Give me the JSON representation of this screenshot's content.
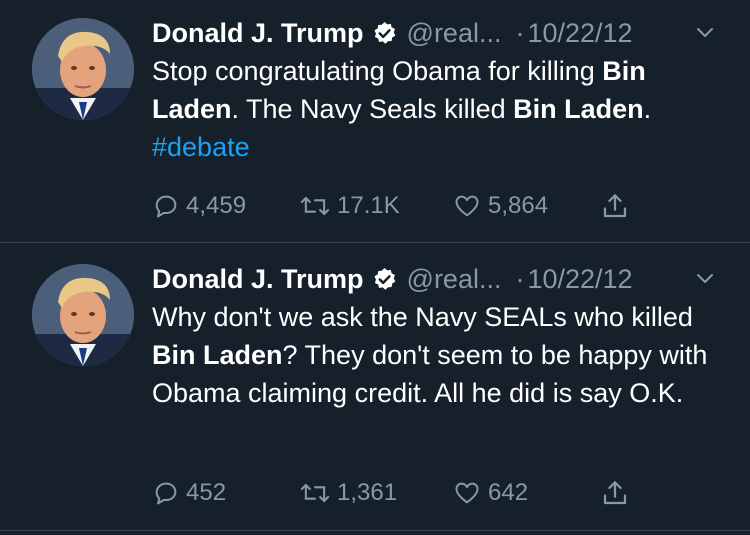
{
  "colors": {
    "background": "#15202b",
    "divider": "#38444d",
    "secondary_text": "#8899a6",
    "hashtag": "#1da1f2",
    "verified_badge": "#ffffff"
  },
  "icons": {
    "verified": "verified-badge-icon",
    "menu": "chevron-down-icon",
    "reply": "reply-bubble-icon",
    "retweet": "retweet-arrows-icon",
    "like": "heart-icon",
    "share": "share-upload-icon"
  },
  "tweets": [
    {
      "author_name": "Donald J. Trump",
      "handle": "@real...",
      "separator": "·",
      "date": "10/22/12",
      "text": {
        "p1": "Stop congratulating Obama for killing ",
        "b1": "Bin",
        "p2": " ",
        "b2": "Laden",
        "p3": ". The Navy Seals killed ",
        "b3": "Bin Laden",
        "p4": ".",
        "hashtag": "#debate"
      },
      "replies": "4,459",
      "retweets": "17.1K",
      "likes": "5,864"
    },
    {
      "author_name": "Donald J. Trump",
      "handle": "@real...",
      "separator": "·",
      "date": "10/22/12",
      "text": {
        "p1": "Why don't we ask the Navy SEALs who killed ",
        "b1": "Bin Laden",
        "p2": "? They don't seem to be happy with Obama claiming credit. All he did is say O.K."
      },
      "replies": "452",
      "retweets": "1,361",
      "likes": "642"
    }
  ]
}
